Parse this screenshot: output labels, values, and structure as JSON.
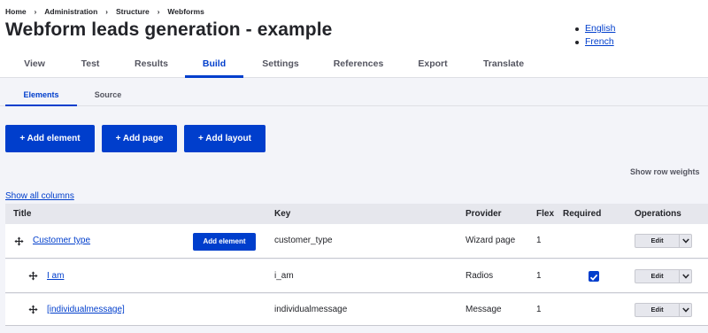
{
  "breadcrumb": [
    "Home",
    "Administration",
    "Structure",
    "Webforms"
  ],
  "breadcrumb_separator": "›",
  "page_title": "Webform leads generation - example",
  "languages": [
    "English",
    "French"
  ],
  "primary_tabs": [
    "View",
    "Test",
    "Results",
    "Build",
    "Settings",
    "References",
    "Export",
    "Translate"
  ],
  "secondary_tabs": [
    "Elements",
    "Source"
  ],
  "action_buttons": [
    "+ Add element",
    "+ Add page",
    "+ Add layout"
  ],
  "show_row_weights": "Show row weights",
  "show_all_columns": "Show all columns",
  "table": {
    "headers": [
      "Title",
      "Key",
      "Provider",
      "Flex",
      "Required",
      "Operations"
    ],
    "rows": [
      {
        "title": "Customer type",
        "add_button": "Add element",
        "key": "customer_type",
        "provider": "Wizard page",
        "flex": "1",
        "required": false,
        "operation": "Edit"
      },
      {
        "title": "I am",
        "key": "i_am",
        "provider": "Radios",
        "flex": "1",
        "required": true,
        "operation": "Edit"
      },
      {
        "title": "[individualmessage]",
        "key": "individualmessage",
        "provider": "Message",
        "flex": "1",
        "required": false,
        "operation": "Edit"
      }
    ]
  },
  "colors": {
    "accent": "#003ecc",
    "text": "#232429",
    "content_bg": "#f3f4f9"
  }
}
